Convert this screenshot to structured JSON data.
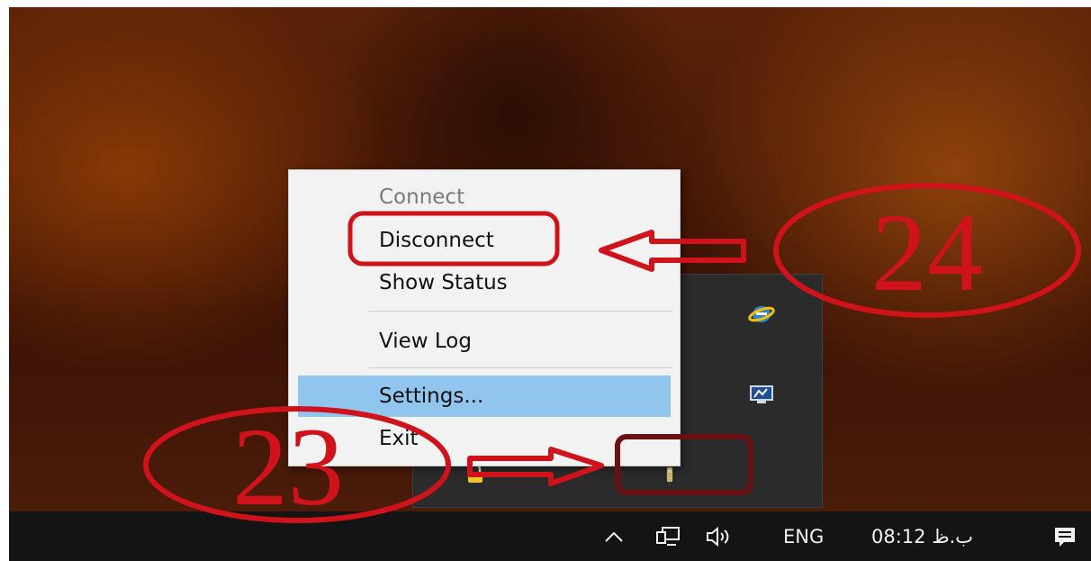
{
  "context_menu": {
    "items": [
      {
        "label": "Connect",
        "state": "disabled"
      },
      {
        "label": "Disconnect",
        "state": "normal"
      },
      {
        "label": "Show Status",
        "state": "normal"
      },
      {
        "label": "View Log",
        "state": "normal"
      },
      {
        "label": "Settings...",
        "state": "highlighted"
      },
      {
        "label": "Exit",
        "state": "normal"
      }
    ]
  },
  "tray_flyout": {
    "icons": [
      "ie-browser-icon",
      "network-monitor-icon",
      "vpn-client-icon",
      "lock-icon"
    ]
  },
  "taskbar": {
    "language": "ENG",
    "clock": "08:12 ب.ظ",
    "icons": [
      "chevron-up-icon",
      "network-icon",
      "volume-icon",
      "action-center-icon"
    ]
  },
  "annotations": {
    "label_24": "24",
    "label_23": "23",
    "color": "#d0121b"
  },
  "colors": {
    "menu_highlight": "#90c5ee",
    "menu_background": "#f2f2f2",
    "taskbar": "#141414"
  }
}
